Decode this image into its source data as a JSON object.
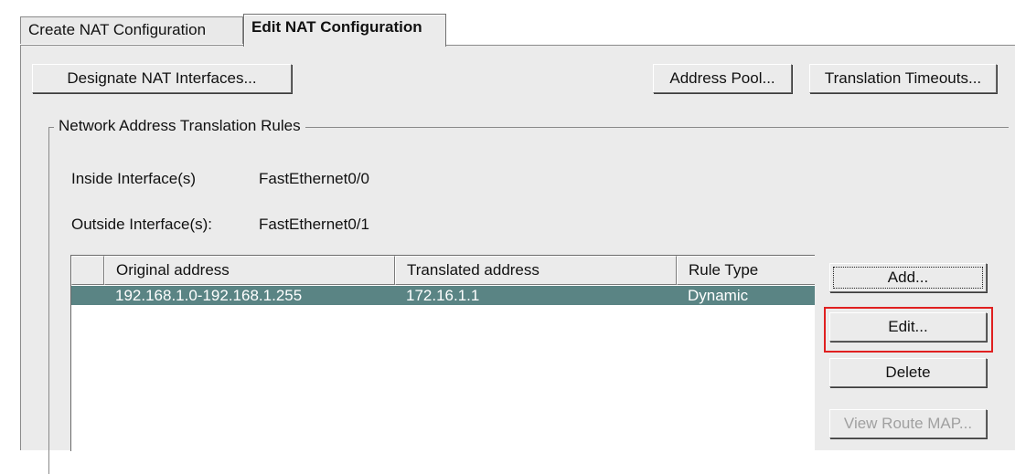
{
  "tabs": [
    {
      "label": "Create NAT Configuration",
      "active": false
    },
    {
      "label": "Edit NAT Configuration",
      "active": true
    }
  ],
  "toolbar": {
    "designate_label": "Designate NAT Interfaces...",
    "address_pool_label": "Address Pool...",
    "translation_timeouts_label": "Translation Timeouts..."
  },
  "rules_group": {
    "title": "Network Address Translation Rules",
    "inside_label": "Inside Interface(s)",
    "inside_value": "FastEthernet0/0",
    "outside_label": "Outside Interface(s):",
    "outside_value": "FastEthernet0/1"
  },
  "table": {
    "columns": [
      "Original address",
      "Translated address",
      "Rule Type"
    ],
    "rows": [
      {
        "original": "192.168.1.0-192.168.1.255",
        "translated": "172.16.1.1",
        "rule_type": "Dynamic",
        "selected": true
      }
    ]
  },
  "actions": {
    "add_label": "Add...",
    "edit_label": "Edit...",
    "delete_label": "Delete",
    "view_route_map_label": "View Route MAP..."
  },
  "colors": {
    "selected_row": "#5a8484",
    "highlight_border": "#e02020",
    "panel_bg": "#ebebeb"
  }
}
